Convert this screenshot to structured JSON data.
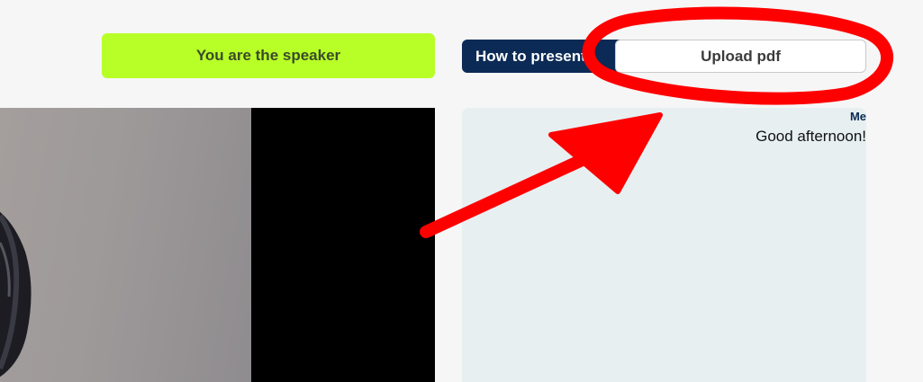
{
  "header": {
    "speaker_badge": "You are the speaker",
    "howto_label": "How to present?",
    "upload_label": "Upload pdf"
  },
  "chat": {
    "messages": [
      {
        "sender": "Me",
        "text": "Good afternoon!"
      }
    ]
  },
  "colors": {
    "accent_green": "#b8ff27",
    "navy": "#0b2a55",
    "annotation_red": "#ff0000",
    "chat_bg": "#e7eff1"
  }
}
